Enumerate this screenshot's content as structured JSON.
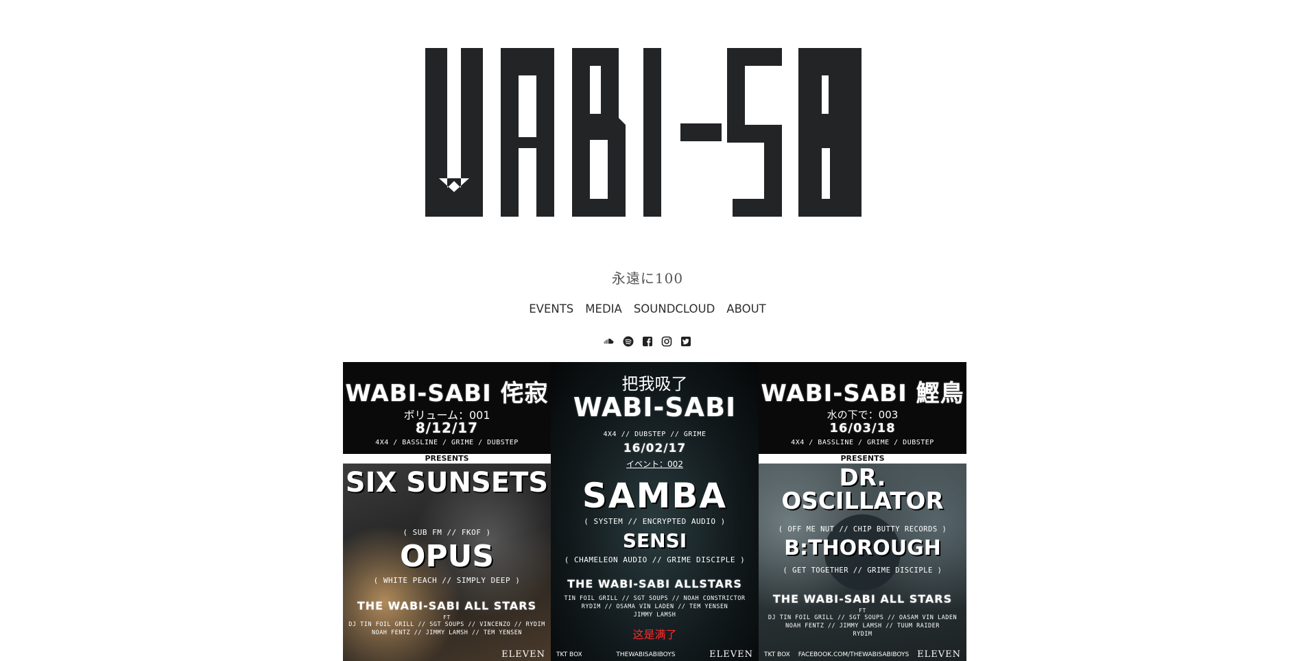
{
  "site": {
    "logo_text": "WABI-SABI",
    "tagline": "永遠に100"
  },
  "nav": [
    {
      "label": "EVENTS"
    },
    {
      "label": "MEDIA"
    },
    {
      "label": "SOUNDCLOUD"
    },
    {
      "label": "ABOUT"
    }
  ],
  "social": [
    "soundcloud-icon",
    "spotify-icon",
    "facebook-icon",
    "instagram-icon",
    "twitter-icon"
  ],
  "posters": [
    {
      "title": "WABI-SABI 侘寂",
      "volume": "ボリューム：001",
      "date": "8/12/17",
      "genres": "4X4 / BASSLINE / GRIME / DUBSTEP",
      "band": "PRESENTS",
      "headliner1": "SIX SUNSETS",
      "headliner1_sub": "( SUB FM // FKOF )",
      "headliner2": "OPUS",
      "headliner2_sub": "( WHITE PEACH // SIMPLY DEEP )",
      "allstars": "THE WABI-SABI ALL STARS",
      "ft": "FT",
      "lineup1": "DJ TIN FOIL GRILL // SGT SOUPS // VINCENZO // RYDIM",
      "lineup2": "NOAH FENTZ // JIMMY LAMSH // TEM YENSEN",
      "venue": "ELEVEN"
    },
    {
      "kicker": "把我吸了",
      "title": "WABI-SABI",
      "genres": "4X4 // DUBSTEP // GRIME",
      "date": "16/02/17",
      "event_no": "イベント：002",
      "headliner1": "SAMBA",
      "headliner1_sub": "( SYSTEM // ENCRYPTED AUDIO )",
      "headliner2": "SENSI",
      "headliner2_sub": "( CHAMELEON AUDIO // GRIME DISCIPLE )",
      "allstars": "THE WABI-SABI ALLSTARS",
      "lineup1": "TIN FOIL GRILL // SGT SOUPS // NOAH CONSTRICTOR",
      "lineup2": "RYDIM // OSAMA VIN LADEN // TEM YENSEN",
      "lineup3": "JIMMY LAMSH",
      "soldout": "这是满了",
      "ticket": "TKT BOX",
      "social_handle": "THEWABISABIBOYS",
      "venue": "ELEVEN"
    },
    {
      "title": "WABI-SABI 鰹鳥",
      "volume": "水の下で：003",
      "date": "16/03/18",
      "genres": "4X4 / BASSLINE / GRIME / DUBSTEP",
      "band": "PRESENTS",
      "headliner1": "DR. OSCILLATOR",
      "headliner1_sub": "( OFF ME NUT // CHIP BUTTY RECORDS )",
      "headliner2": "B:THOROUGH",
      "headliner2_sub": "( GET TOGETHER // GRIME DISCIPLE )",
      "allstars": "THE WABI-SABI ALL STARS",
      "ft": "FT",
      "lineup1": "DJ TIN FOIL GRILL // SGT SOUPS // OASAM VIN LADEN",
      "lineup2": "NOAH FENTZ // JIMMY LAMSH // TUUM RAIDER",
      "lineup3": "RYDIM",
      "ticket": "TKT BOX",
      "social_handle": "FACEBOOK.COM/THEWABISABIBOYS",
      "venue": "ELEVEN"
    }
  ]
}
